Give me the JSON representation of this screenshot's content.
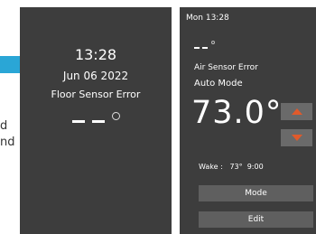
{
  "left_fragment": {
    "line1": "d",
    "line2": "nd"
  },
  "left_screen": {
    "time": "13:28",
    "date": "Jun 06 2022",
    "error": "Floor Sensor Error"
  },
  "right_screen": {
    "status_bar": "Mon 13:28",
    "air_error": "Air Sensor Error",
    "mode_label": "Auto Mode",
    "temperature": "73.0°",
    "wake": "Wake :   73°  9:00",
    "mode_button": "Mode",
    "edit_button": "Edit"
  },
  "colors": {
    "accent": "#2aa6d6",
    "arrow": "#e05a2b",
    "screen_bg": "#3d3d3d"
  }
}
